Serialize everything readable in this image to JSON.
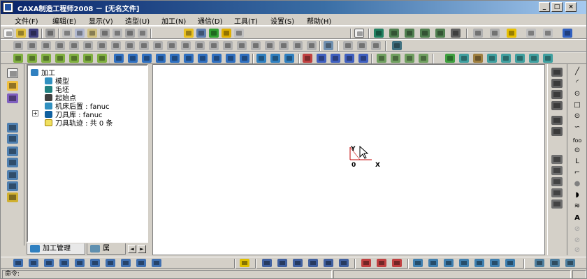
{
  "window": {
    "title": "CAXA制造工程师2008 － [无名文件]",
    "minimize": "_",
    "maximize": "□",
    "close": "×"
  },
  "menu": [
    "文件(F)",
    "编辑(E)",
    "显示(V)",
    "造型(U)",
    "加工(N)",
    "通信(D)",
    "工具(T)",
    "设置(S)",
    "帮助(H)"
  ],
  "tree": {
    "root": "加工",
    "items": [
      {
        "label": "模型",
        "icon": "model-icon"
      },
      {
        "label": "毛坯",
        "icon": "stock-icon"
      },
      {
        "label": "起始点",
        "icon": "start-point-icon"
      },
      {
        "label": "机床后置 : fanuc",
        "icon": "machine-post-icon"
      },
      {
        "label": "刀具库 : fanuc",
        "icon": "tool-library-icon"
      },
      {
        "label": "刀具轨迹 : 共 0 条",
        "icon": "toolpath-icon"
      }
    ],
    "expander": "+"
  },
  "tabs": [
    {
      "label": "加工管理",
      "icon": "machining-manager-icon"
    },
    {
      "label": "属",
      "icon": "properties-icon"
    }
  ],
  "scroll": {
    "left": "◄",
    "right": "►"
  },
  "canvas": {
    "axis_y_label": "Y",
    "axis_x_label": "X",
    "origin_label": "0"
  },
  "right_draw_tools": [
    "╱",
    "◜",
    "⊙",
    "□",
    "⊙",
    "∽",
    "foo",
    "⊙",
    "L",
    "⌐",
    "●",
    "◗",
    "≋",
    "A",
    "⊘",
    "⊘",
    "⊘"
  ],
  "status": {
    "command_label": "命令:"
  },
  "colors": {
    "titlebar_start": "#0a246a",
    "titlebar_end": "#a6caf0",
    "axis": "#c00000"
  }
}
